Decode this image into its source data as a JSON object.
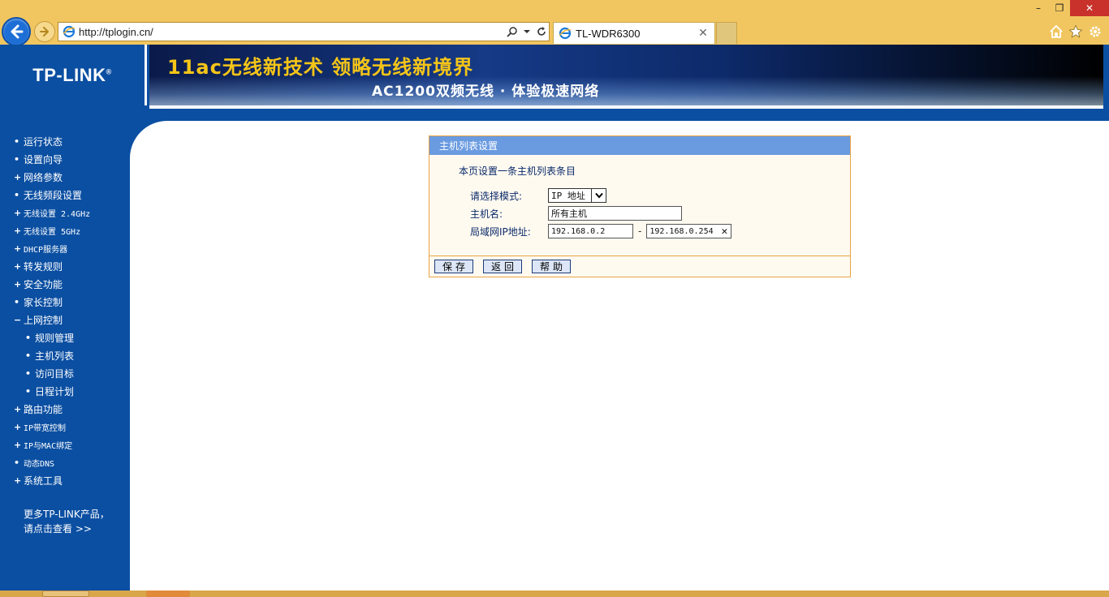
{
  "browser": {
    "url": "http://tplogin.cn/",
    "tab_title": "TL-WDR6300",
    "window_controls": {
      "minimize": "–",
      "maximize": "❐",
      "close": "✕"
    },
    "icons": [
      "back-arrow-icon",
      "forward-arrow-icon",
      "ie-icon",
      "search-icon",
      "dropdown-icon",
      "refresh-icon",
      "home-icon",
      "favorites-star-icon",
      "settings-gear-icon"
    ]
  },
  "header": {
    "logo": "TP-LINK",
    "logo_mark": "®",
    "banner_line1": "11ac无线新技术 领略无线新境界",
    "banner_line2": "AC1200双频无线 · 体验极速网络"
  },
  "sidebar": {
    "items": [
      {
        "mark": "•",
        "label": "运行状态",
        "mono": false
      },
      {
        "mark": "•",
        "label": "设置向导",
        "mono": false
      },
      {
        "mark": "+",
        "label": "网络参数",
        "mono": false
      },
      {
        "mark": "•",
        "label": "无线频段设置",
        "mono": false
      },
      {
        "mark": "+",
        "label": "无线设置 2.4GHz",
        "mono": false
      },
      {
        "mark": "+",
        "label": "无线设置 5GHz",
        "mono": false
      },
      {
        "mark": "+",
        "label": "DHCP服务器",
        "mono": false
      },
      {
        "mark": "+",
        "label": "转发规则",
        "mono": false
      },
      {
        "mark": "+",
        "label": "安全功能",
        "mono": false
      },
      {
        "mark": "•",
        "label": "家长控制",
        "mono": false
      },
      {
        "mark": "−",
        "label": "上网控制",
        "mono": false
      },
      {
        "mark": "•",
        "label": "规则管理",
        "mono": false,
        "sub": true
      },
      {
        "mark": "•",
        "label": "主机列表",
        "mono": false,
        "sub": true
      },
      {
        "mark": "•",
        "label": "访问目标",
        "mono": false,
        "sub": true
      },
      {
        "mark": "•",
        "label": "日程计划",
        "mono": false,
        "sub": true
      },
      {
        "mark": "+",
        "label": "路由功能",
        "mono": false
      },
      {
        "mark": "+",
        "label": "IP带宽控制",
        "mono": false
      },
      {
        "mark": "+",
        "label": "IP与MAC绑定",
        "mono": false
      },
      {
        "mark": "•",
        "label": "动态DNS",
        "mono": false
      },
      {
        "mark": "+",
        "label": "系统工具",
        "mono": false
      }
    ],
    "more_line1": "更多TP-LINK产品，",
    "more_line2": "请点击查看 >>"
  },
  "panel": {
    "title": "主机列表设置",
    "description": "本页设置一条主机列表条目",
    "mode_label": "请选择模式:",
    "mode_value": "IP 地址",
    "hostname_label": "主机名:",
    "hostname_value": "所有主机",
    "lan_ip_label": "局域网IP地址:",
    "ip_start": "192.168.0.2",
    "ip_separator": "-",
    "ip_end": "192.168.0.254",
    "buttons": {
      "save": "保存",
      "back": "返回",
      "help": "帮助"
    }
  },
  "colors": {
    "brand_blue": "#0b4fa2",
    "panel_title": "#6a9be0",
    "panel_border": "#e8a444",
    "banner_yellow": "#f5c518"
  }
}
